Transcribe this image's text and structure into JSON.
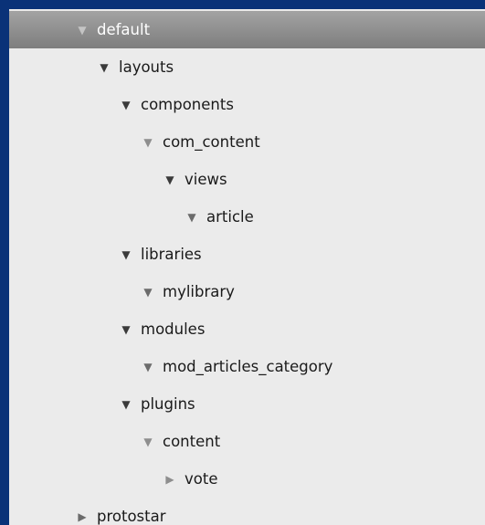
{
  "tree": {
    "items": [
      {
        "label": "default",
        "icon": "triangle-down-icon",
        "expanded": true,
        "selected": true
      },
      {
        "label": "layouts",
        "icon": "triangle-down-icon",
        "expanded": true
      },
      {
        "label": "components",
        "icon": "triangle-down-icon",
        "expanded": true
      },
      {
        "label": "com_content",
        "icon": "triangle-down-icon",
        "expanded": true
      },
      {
        "label": "views",
        "icon": "triangle-down-icon",
        "expanded": true
      },
      {
        "label": "article",
        "icon": "triangle-down-icon",
        "expanded": true
      },
      {
        "label": "libraries",
        "icon": "triangle-down-icon",
        "expanded": true
      },
      {
        "label": "mylibrary",
        "icon": "triangle-down-icon",
        "expanded": true
      },
      {
        "label": "modules",
        "icon": "triangle-down-icon",
        "expanded": true
      },
      {
        "label": "mod_articles_category",
        "icon": "triangle-down-icon",
        "expanded": true
      },
      {
        "label": "plugins",
        "icon": "triangle-down-icon",
        "expanded": true
      },
      {
        "label": "content",
        "icon": "triangle-down-icon",
        "expanded": true
      },
      {
        "label": "vote",
        "icon": "triangle-right-icon",
        "expanded": false
      },
      {
        "label": "protostar",
        "icon": "triangle-right-icon",
        "expanded": false
      }
    ],
    "toggle_glyphs": {
      "expanded": "▼",
      "collapsed": "▶"
    },
    "colors": {
      "background": "#0a3278",
      "panel": "#ebebeb",
      "selected_row": "#8e8e8e",
      "text": "#1a1a1a",
      "selected_text": "#ffffff"
    }
  }
}
